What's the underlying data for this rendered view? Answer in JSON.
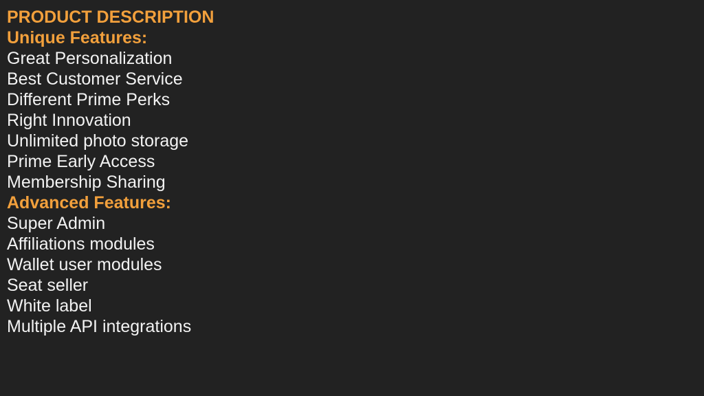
{
  "slide": {
    "background_color": "#222222",
    "heading_color": "#f2a03c",
    "body_color": "#f2f2f2",
    "title": "PRODUCT DESCRIPTION",
    "lines": [
      {
        "text": "PRODUCT DESCRIPTION",
        "style": "heading"
      },
      {
        "text": "Unique Features:",
        "style": "heading"
      },
      {
        "text": "Great Personalization",
        "style": "body"
      },
      {
        "text": "Best Customer Service",
        "style": "body"
      },
      {
        "text": "Different Prime Perks",
        "style": "body"
      },
      {
        "text": "Right Innovation",
        "style": "body"
      },
      {
        "text": "Unlimited photo storage",
        "style": "body"
      },
      {
        "text": "Prime Early Access",
        "style": "body"
      },
      {
        "text": "Membership Sharing",
        "style": "body"
      },
      {
        "text": "Advanced Features:",
        "style": "heading"
      },
      {
        "text": "Super Admin",
        "style": "body"
      },
      {
        "text": "Affiliations modules",
        "style": "body"
      },
      {
        "text": "Wallet user modules",
        "style": "body"
      },
      {
        "text": "Seat seller",
        "style": "body"
      },
      {
        "text": "White label",
        "style": "body"
      },
      {
        "text": "Multiple API integrations",
        "style": "body"
      }
    ]
  }
}
